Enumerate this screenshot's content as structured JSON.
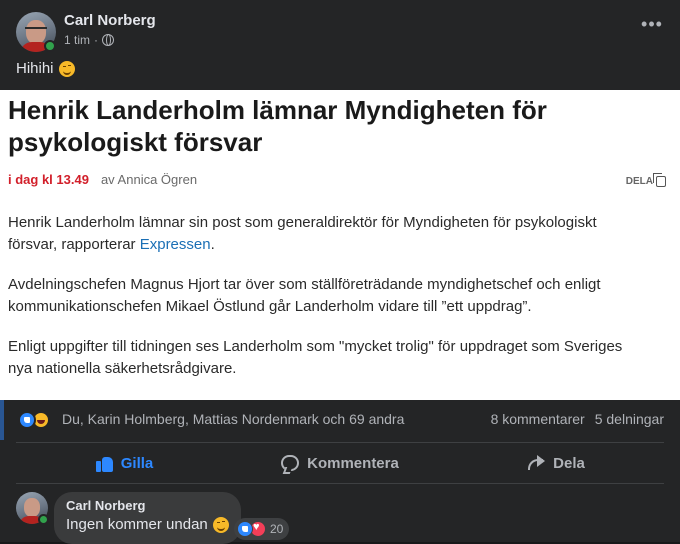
{
  "post": {
    "author": "Carl Norberg",
    "time": "1 tim",
    "separator": "·",
    "more_label": "•••",
    "text": "Hihihi"
  },
  "article": {
    "title": "Henrik Landerholm lämnar Myndigheten för psykologiskt försvar",
    "time": "i dag kl 13.49",
    "byline": "av Annica Ögren",
    "share_label": "DELA",
    "p1_before": "Henrik Landerholm lämnar sin post som generaldirektör för Myndigheten för psykologiskt försvar, rapporterar ",
    "p1_link": "Expressen",
    "p1_after": ".",
    "p2": "Avdelningschefen Magnus Hjort tar över som ställföreträdande myndighetschef och enligt kommunikationschefen Mikael Östlund går Landerholm vidare till ”ett uppdrag”.",
    "p3": "Enligt uppgifter till tidningen ses Landerholm som \"mycket trolig\" för uppdraget som Sveriges nya nationella säkerhetsrådgivare."
  },
  "stats": {
    "reactors": "Du, Karin Holmberg, Mattias Nordenmark och 69 andra",
    "comments": "8 kommentarer",
    "shares": "5 delningar"
  },
  "actions": {
    "like": "Gilla",
    "comment": "Kommentera",
    "share": "Dela"
  },
  "comment": {
    "author": "Carl Norberg",
    "text": "Ingen kommer undan",
    "reaction_count": "20"
  },
  "colors": {
    "accent": "#2d88ff",
    "background": "#242526",
    "online": "#31a24c"
  }
}
